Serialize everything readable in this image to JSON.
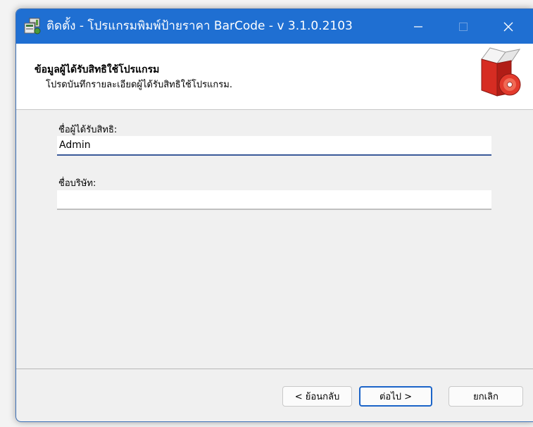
{
  "window": {
    "title": "ติดตั้ง - โปรแกรมพิมพ์ป้ายราคา BarCode - v 3.1.0.2103",
    "titlebar_color": "#1f6fd2",
    "app_icon": "installer-icon",
    "controls": {
      "minimize_icon": "minimize-icon",
      "maximize_icon": "maximize-icon",
      "close_icon": "close-icon"
    }
  },
  "header": {
    "title": "ข้อมูลผู้ได้รับสิทธิใช้โปรแกรม",
    "subtitle": "โปรดบันทึกรายละเอียดผู้ได้รับสิทธิใช้โปรแกรม.",
    "icon": "software-box-icon"
  },
  "form": {
    "licensee_label": "ชื่อผู้ได้รับสิทธิ:",
    "licensee_value": "Admin",
    "company_label": "ชื่อบริษัท:",
    "company_value": ""
  },
  "buttons": {
    "back": "< ย้อนกลับ",
    "next": "ต่อไป >",
    "cancel": "ยกเลิก"
  }
}
